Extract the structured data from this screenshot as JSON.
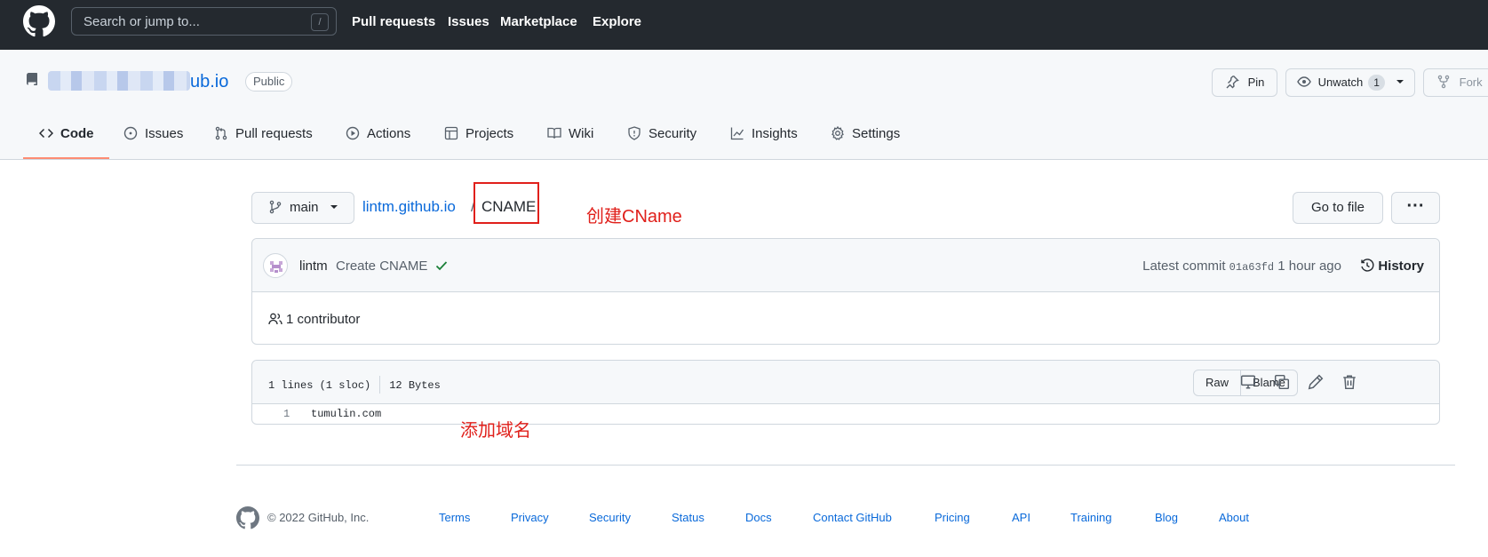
{
  "header": {
    "search_placeholder": "Search or jump to...",
    "search_shortcut": "/",
    "nav": [
      "Pull requests",
      "Issues",
      "Marketplace",
      "Explore"
    ]
  },
  "repo": {
    "name_suffix": "ub.io",
    "visibility": "Public",
    "actions": {
      "pin": "Pin",
      "unwatch": "Unwatch",
      "watch_count": "1",
      "fork": "Fork"
    }
  },
  "tabs": [
    {
      "label": "Code",
      "icon": "code-icon",
      "active": true
    },
    {
      "label": "Issues",
      "icon": "issue-icon"
    },
    {
      "label": "Pull requests",
      "icon": "pull-request-icon"
    },
    {
      "label": "Actions",
      "icon": "play-icon"
    },
    {
      "label": "Projects",
      "icon": "table-icon"
    },
    {
      "label": "Wiki",
      "icon": "book-icon"
    },
    {
      "label": "Security",
      "icon": "shield-icon"
    },
    {
      "label": "Insights",
      "icon": "graph-icon"
    },
    {
      "label": "Settings",
      "icon": "gear-icon"
    }
  ],
  "file_nav": {
    "branch": "main",
    "repo_link": "lintm.github.io",
    "separator": "/",
    "file_name": "CNAME",
    "go_to_file": "Go to file",
    "more": "···"
  },
  "annotations": {
    "create_cname": "创建CName",
    "add_domain": "添加域名",
    "color": "#e0201b"
  },
  "commit": {
    "author": "lintm",
    "message": "Create CNAME",
    "latest_label": "Latest commit",
    "sha": "01a63fd",
    "time": "1 hour ago",
    "history": "History",
    "contributors": "1 contributor"
  },
  "file": {
    "lines": "1 lines (1 sloc)",
    "size": "12 Bytes",
    "raw": "Raw",
    "blame": "Blame",
    "code": [
      {
        "num": "1",
        "text": "tumulin.com"
      }
    ]
  },
  "footer": {
    "copyright": "© 2022 GitHub, Inc.",
    "links": [
      "Terms",
      "Privacy",
      "Security",
      "Status",
      "Docs",
      "Contact GitHub",
      "Pricing",
      "API",
      "Training",
      "Blog",
      "About"
    ]
  }
}
